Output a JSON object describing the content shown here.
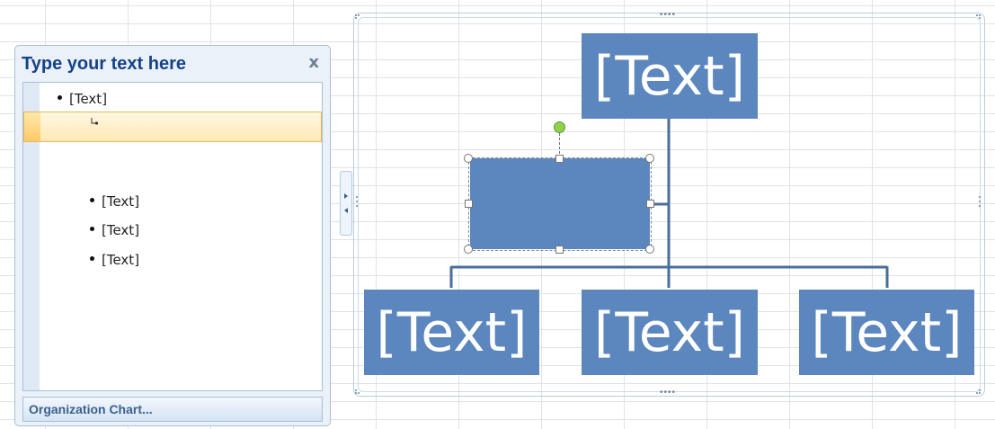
{
  "text_pane": {
    "title": "Type your text here",
    "close_label": "x",
    "items": [
      {
        "text": "[Text]",
        "level": 1
      },
      {
        "text": "",
        "level": 2,
        "selected": true
      },
      {
        "text": "[Text]",
        "level": 2
      },
      {
        "text": "[Text]",
        "level": 2
      },
      {
        "text": "[Text]",
        "level": 2
      }
    ],
    "footer_label": "Organization Chart..."
  },
  "smartart": {
    "top_node": "[Text]",
    "assistant_node": "",
    "child_nodes": [
      "[Text]",
      "[Text]",
      "[Text]"
    ],
    "frame_handle_glyph": "••••"
  },
  "colors": {
    "shape_fill": "#5b86be",
    "connector": "#4a6d9a",
    "pane_title": "#15428b",
    "selection_highlight": "#ffe9b5",
    "rotation_handle": "#8ed14f"
  },
  "icons": {
    "close": "close-icon",
    "expand_collapse": "expand-collapse-arrows-icon",
    "assistant_bullet": "assistant-bullet-icon"
  }
}
